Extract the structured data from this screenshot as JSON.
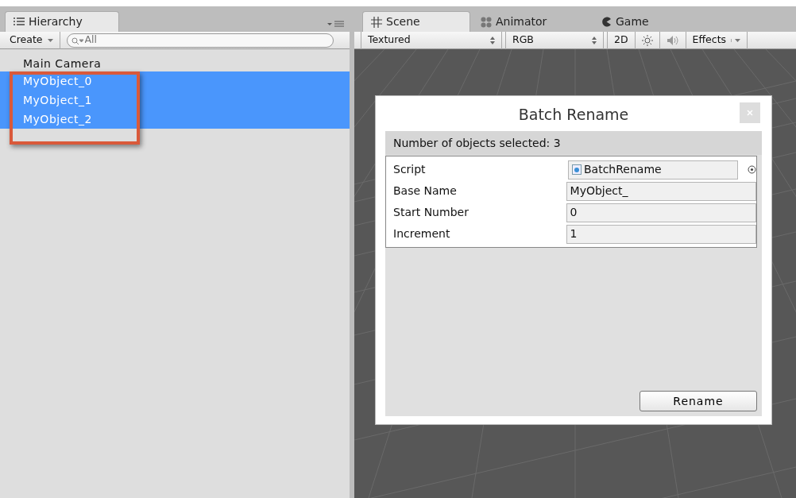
{
  "hierarchy": {
    "tab": "Hierarchy",
    "create": "Create",
    "search": {
      "placeholder": "All"
    },
    "items": [
      {
        "label": "Main Camera",
        "selected": false
      },
      {
        "label": "MyObject_0",
        "selected": true
      },
      {
        "label": "MyObject_1",
        "selected": true
      },
      {
        "label": "MyObject_2",
        "selected": true
      }
    ]
  },
  "scene": {
    "tabs": [
      {
        "label": "Scene",
        "kind": "scene",
        "selected": true
      },
      {
        "label": "Animator",
        "kind": "animator",
        "selected": false
      },
      {
        "label": "Game",
        "kind": "game",
        "selected": false
      }
    ],
    "toolbar": {
      "shading": "Textured",
      "channels": "RGB",
      "mode": "2D",
      "audio_on": false,
      "effects": "Effects"
    }
  },
  "dialog": {
    "title": "Batch Rename",
    "summary": "Number of objects selected: 3",
    "fields": [
      {
        "label": "Script",
        "value": "BatchRename",
        "kind": "script"
      },
      {
        "label": "Base Name",
        "value": "MyObject_",
        "kind": "text"
      },
      {
        "label": "Start Number",
        "value": "0",
        "kind": "text"
      },
      {
        "label": "Increment",
        "value": "1",
        "kind": "text"
      }
    ],
    "button": "Rename"
  }
}
